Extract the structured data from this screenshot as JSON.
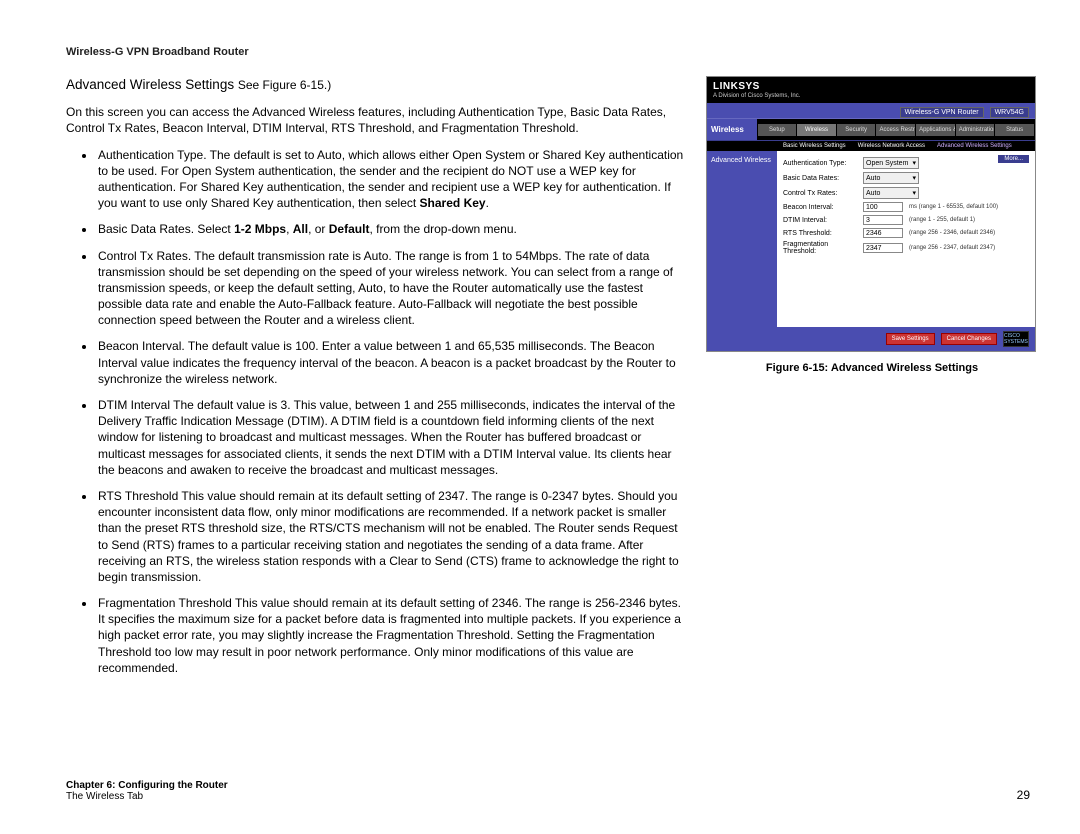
{
  "doc_header": "Wireless-G VPN Broadband Router",
  "section": {
    "lead": "Advanced Wireless Settings ",
    "trail": "See Figure 6-15.)"
  },
  "intro": "On this screen you can access the Advanced Wireless features, including Authentication Type, Basic Data Rates, Control Tx Rates, Beacon Interval, DTIM Interval, RTS Threshold, and Fragmentation Threshold.",
  "bullets": {
    "b1a": "Authentication Type. The default is set to Auto, which allows either Open System or Shared Key authentication to be used. For Open System authentication, the sender and the recipient do NOT use a WEP key for authentication. For Shared Key authentication, the sender and recipient use a WEP key for authentication. If you want to use only Shared Key authentication, then select ",
    "b1b": "Shared Key",
    "b1c": ".",
    "b2a": "Basic Data Rates. Select ",
    "b2b": "1-2 Mbps",
    "b2c": ", ",
    "b2d": "All",
    "b2e": ", or ",
    "b2f": "Default",
    "b2g": ", from the drop-down menu.",
    "b3": "Control Tx Rates. The default transmission rate is Auto. The range is from 1 to 54Mbps. The rate of data transmission should be set depending on the speed of your wireless network. You can select from a range of transmission speeds, or keep the default setting, Auto, to have the Router automatically use the fastest possible data rate and enable the Auto-Fallback feature. Auto-Fallback will negotiate the best possible connection speed between the Router and a wireless client.",
    "b4": "Beacon Interval. The default value is 100. Enter a value between 1 and 65,535 milliseconds. The Beacon Interval value indicates the frequency interval of the beacon. A beacon is a packet broadcast by the Router to synchronize the wireless network.",
    "b5": "DTIM Interval  The default value is 3. This value, between 1 and 255 milliseconds, indicates the interval of the Delivery Traffic Indication Message (DTIM). A DTIM field is a countdown field informing clients of the next window for listening to broadcast and multicast messages. When the Router has buffered broadcast or multicast messages for associated clients, it sends the next DTIM with a DTIM Interval value.  Its clients hear the beacons and awaken to receive the broadcast and multicast messages.",
    "b6": "RTS Threshold  This value should remain at its default setting of 2347. The range is 0-2347 bytes. Should you encounter inconsistent data flow, only minor modifications are recommended. If a network packet is smaller than the preset RTS threshold size, the RTS/CTS mechanism will not be enabled. The Router sends Request to Send (RTS) frames to a particular receiving station and negotiates the sending of a data frame. After receiving an RTS, the wireless station responds with a Clear to Send (CTS) frame to acknowledge the right to begin transmission.",
    "b7": "Fragmentation Threshold  This value should remain at its default setting of 2346. The range is 256-2346 bytes. It specifies the maximum size for a packet before data is fragmented into multiple packets. If you experience a high packet error rate, you may slightly increase the Fragmentation Threshold. Setting the Fragmentation Threshold too low may result in poor network performance. Only minor modifications of this value are recommended."
  },
  "figure": {
    "brand": "LINKSYS",
    "brand_sub": "A Division of Cisco Systems, Inc.",
    "title_product": "Wireless-G VPN Router",
    "title_model": "WRV54G",
    "section_label": "Wireless",
    "tabs": [
      "Setup",
      "Wireless",
      "Security",
      "Access Restrictions",
      "Applications & Gaming",
      "Administration",
      "Status"
    ],
    "subtabs": {
      "a": "Basic Wireless Settings",
      "b": "Wireless Network Access",
      "c": "Advanced Wireless Settings"
    },
    "sidebar_label": "Advanced Wireless",
    "more": "More...",
    "rows": {
      "auth": {
        "label": "Authentication Type:",
        "value": "Open System"
      },
      "bdr": {
        "label": "Basic Data Rates:",
        "value": "Auto"
      },
      "ctx": {
        "label": "Control Tx Rates:",
        "value": "Auto"
      },
      "bi": {
        "label": "Beacon Interval:",
        "value": "100",
        "hint": "ms (range 1 - 65535, default 100)"
      },
      "dtim": {
        "label": "DTIM Interval:",
        "value": "3",
        "hint": "(range 1 - 255, default 1)"
      },
      "rts": {
        "label": "RTS Threshold:",
        "value": "2346",
        "hint": "(range 256 - 2346, default 2346)"
      },
      "frag": {
        "label": "Fragmentation Threshold:",
        "value": "2347",
        "hint": "(range 256 - 2347, default 2347)"
      }
    },
    "btn_save": "Save Settings",
    "btn_cancel": "Cancel Changes",
    "cisco": "CISCO SYSTEMS"
  },
  "caption": "Figure 6-15: Advanced Wireless Settings",
  "footer": {
    "chapter": "Chapter 6: Configuring the Router",
    "tab": "The Wireless Tab",
    "page": "29"
  }
}
